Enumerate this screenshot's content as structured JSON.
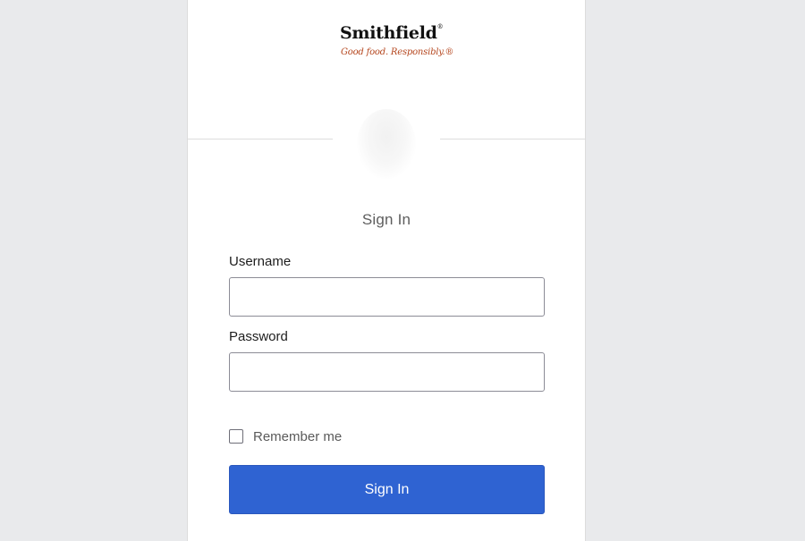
{
  "brand": {
    "name": "Smithfield",
    "registered_mark": "®",
    "tagline": "Good food. Responsibly.®",
    "tagline_color": "#b5471f"
  },
  "avatar": {
    "icon": "user-avatar-icon"
  },
  "form": {
    "title": "Sign In",
    "username": {
      "label": "Username",
      "value": "",
      "placeholder": ""
    },
    "password": {
      "label": "Password",
      "value": "",
      "placeholder": ""
    },
    "remember_me": {
      "label": "Remember me",
      "checked": false
    },
    "submit_label": "Sign In"
  },
  "colors": {
    "background": "#e9eaec",
    "card": "#ffffff",
    "primary_button": "#2f63d2",
    "title_text": "#5e5e5e"
  }
}
